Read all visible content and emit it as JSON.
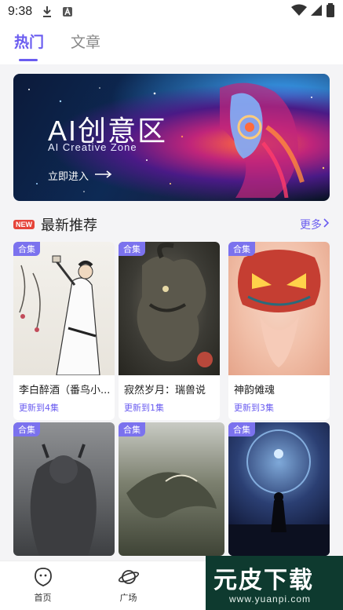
{
  "status": {
    "time": "9:38"
  },
  "tabs": [
    {
      "label": "热门",
      "active": true
    },
    {
      "label": "文章",
      "active": false
    }
  ],
  "banner": {
    "title": "AI创意区",
    "subtitle": "AI Creative Zone",
    "cta": "立即进入"
  },
  "section": {
    "badge": "NEW",
    "title": "最新推荐",
    "more": "更多"
  },
  "cards": [
    {
      "tag": "合集",
      "name": "李白醉酒（番鸟小...",
      "update": "更新到4集"
    },
    {
      "tag": "合集",
      "name": "寂然岁月：瑞兽说",
      "update": "更新到1集"
    },
    {
      "tag": "合集",
      "name": "神韵傩魂",
      "update": "更新到3集"
    },
    {
      "tag": "合集",
      "name": "",
      "update": ""
    },
    {
      "tag": "合集",
      "name": "",
      "update": ""
    },
    {
      "tag": "合集",
      "name": "",
      "update": ""
    }
  ],
  "nav": [
    {
      "label": "首页",
      "icon": "home-icon"
    },
    {
      "label": "广场",
      "icon": "planet-icon"
    }
  ],
  "watermark": {
    "big": "元皮下载",
    "url": "www.yuanpi.com"
  },
  "colors": {
    "accent": "#6a5cf0",
    "badge": "#e6453a",
    "tag": "#7b72ee"
  }
}
